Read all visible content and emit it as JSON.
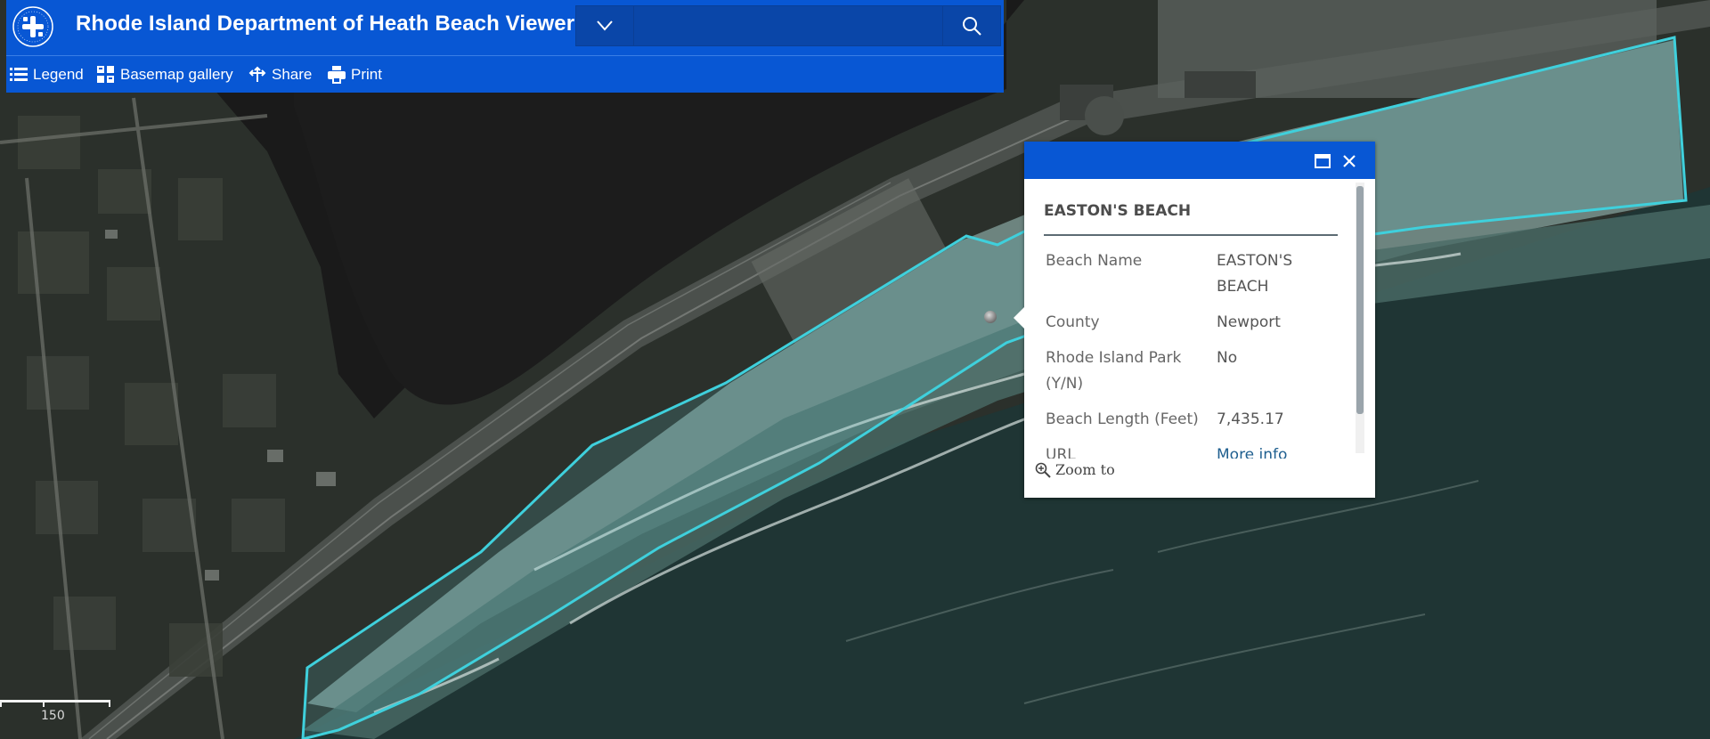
{
  "app": {
    "title": "Rhode Island Department of Heath Beach Viewer",
    "accent_color": "#0857d4",
    "logo_icon": "ri-department-of-health-seal"
  },
  "search": {
    "placeholder": "",
    "value": ""
  },
  "toolbar": {
    "items": [
      {
        "label": "Legend",
        "icon": "list-icon"
      },
      {
        "label": "Basemap gallery",
        "icon": "grid-icon"
      },
      {
        "label": "Share",
        "icon": "share-icon"
      },
      {
        "label": "Print",
        "icon": "printer-icon"
      }
    ]
  },
  "popup": {
    "title": "EASTON'S BEACH",
    "fields": [
      {
        "label": "Beach Name",
        "value": "EASTON'S BEACH"
      },
      {
        "label": "County",
        "value": "Newport"
      },
      {
        "label": "Rhode Island Park (Y/N)",
        "value": "No"
      },
      {
        "label": "Beach Length (Feet)",
        "value": "7,435.17"
      },
      {
        "label": "URL",
        "value": "More info"
      }
    ],
    "zoom_to_label": "Zoom to"
  },
  "map": {
    "scale_label": "150",
    "beach_outline_color": "#3fd0dc"
  }
}
